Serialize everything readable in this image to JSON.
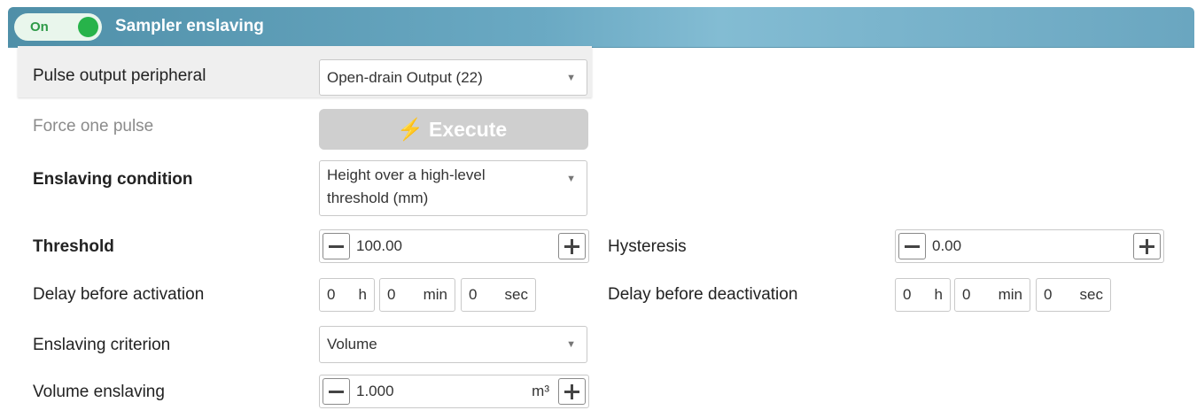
{
  "header": {
    "toggle_label": "On",
    "title": "Sampler enslaving",
    "accent": "#27b34a",
    "bar_color": "#6aa9c3"
  },
  "rows": {
    "pulse_output": {
      "label": "Pulse output peripheral",
      "value": "Open-drain Output (22)"
    },
    "force_pulse": {
      "label": "Force one pulse",
      "button_label": "Execute",
      "button_icon": "lightning-bolt-icon"
    },
    "condition": {
      "label": "Enslaving condition",
      "value_line1": "Height over a high-level",
      "value_line2": "threshold (mm)"
    },
    "threshold": {
      "label": "Threshold",
      "value": "100.00"
    },
    "hysteresis": {
      "label": "Hysteresis",
      "value": "0.00"
    },
    "delay_activation": {
      "label": "Delay before activation",
      "h": "0",
      "h_unit": "h",
      "min": "0",
      "min_unit": "min",
      "sec": "0",
      "sec_unit": "sec"
    },
    "delay_deactivation": {
      "label": "Delay before deactivation",
      "h": "0",
      "h_unit": "h",
      "min": "0",
      "min_unit": "min",
      "sec": "0",
      "sec_unit": "sec"
    },
    "criterion": {
      "label": "Enslaving criterion",
      "value": "Volume"
    },
    "volume": {
      "label": "Volume enslaving",
      "value": "1.000",
      "unit": "m³"
    }
  }
}
